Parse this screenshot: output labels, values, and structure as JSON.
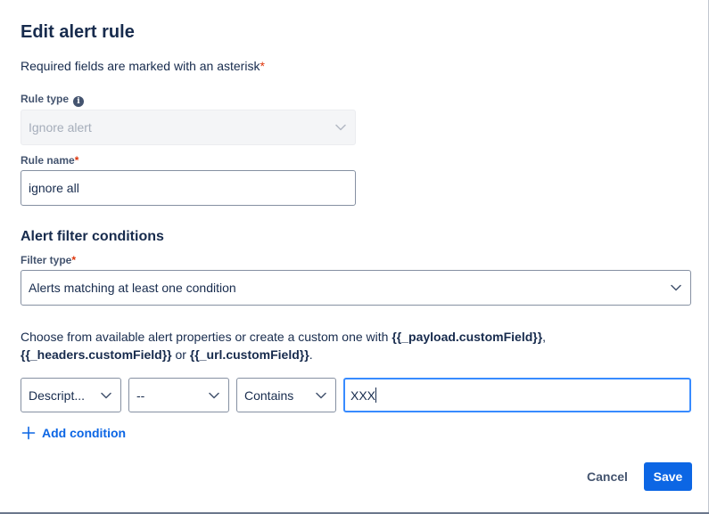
{
  "dialog": {
    "title": "Edit alert rule",
    "required_note": "Required fields are marked with an asterisk",
    "asterisk": "*"
  },
  "rule_type": {
    "label": "Rule type",
    "info_icon": "i",
    "value": "Ignore alert"
  },
  "rule_name": {
    "label": "Rule name",
    "value": "ignore all"
  },
  "filter_conditions": {
    "section_title": "Alert filter conditions",
    "filter_type_label": "Filter type",
    "filter_type_value": "Alerts matching at least one condition",
    "help_prefix": "Choose from available alert properties or create a custom one with ",
    "help_code_payload": "{{_payload.customField}}",
    "help_sep1": ", ",
    "help_code_headers": "{{_headers.customField}}",
    "help_sep2": " or ",
    "help_code_url": "{{_url.customField}}",
    "help_suffix": "."
  },
  "condition": {
    "property": "Descript...",
    "sub_property": "--",
    "operator": "Contains",
    "value": "XXX"
  },
  "add_condition_label": "Add condition",
  "actions": {
    "cancel_label": "Cancel",
    "save_label": "Save"
  },
  "colors": {
    "primary": "#0c66e4",
    "required": "#de350b",
    "focus": "#388bff"
  }
}
